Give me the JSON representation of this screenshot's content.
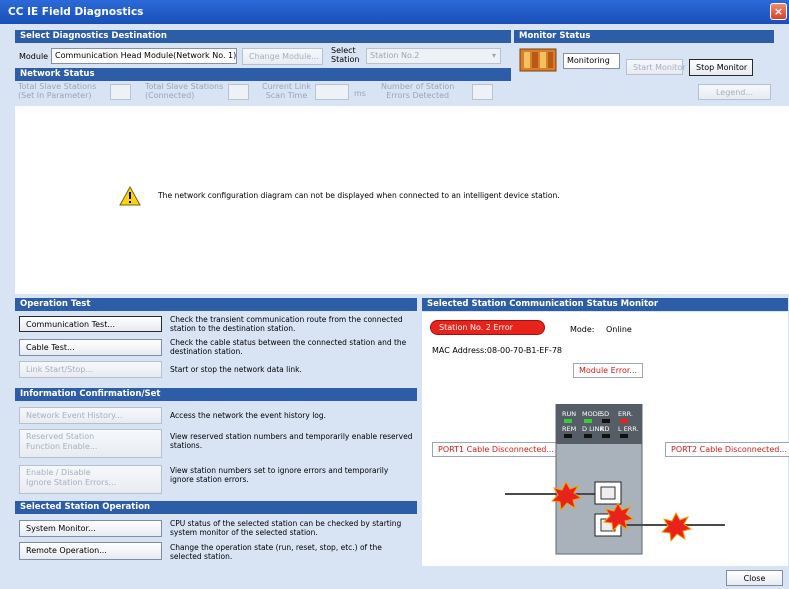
{
  "window": {
    "title": "CC IE Field Diagnostics",
    "close_glyph": "×"
  },
  "destination": {
    "heading": "Select Diagnostics Destination",
    "module_label": "Module",
    "module_value": "Communication Head Module(Network No. 1)",
    "change_module_button": "Change Module...",
    "select_label_1": "Select",
    "select_label_2": "Station",
    "station_value": "Station No.2"
  },
  "monitor": {
    "heading": "Monitor Status",
    "status_text": "Monitoring",
    "start_button": "Start Monitor",
    "stop_button": "Stop Monitor",
    "legend_button": "Legend..."
  },
  "network_status": {
    "heading": "Network Status",
    "total_param_1": "Total Slave Stations",
    "total_param_2": "(Set In Parameter)",
    "total_conn_1": "Total Slave Stations",
    "total_conn_2": "(Connected)",
    "link_scan_1": "Current Link",
    "link_scan_2": "Scan Time",
    "ms_unit": "ms",
    "errors_1": "Number of Station",
    "errors_2": "Errors Detected"
  },
  "diagram_message": "The network configuration diagram can not be displayed when connected to an intelligent device station.",
  "operation_test": {
    "heading": "Operation Test",
    "comm_test_button": "Communication Test...",
    "comm_test_desc": "Check the transient communication route from the connected station to the destination station.",
    "cable_test_button": "Cable Test...",
    "cable_test_desc": "Check the cable status between the connected station and the destination station.",
    "link_button": "Link Start/Stop...",
    "link_desc": "Start or stop the network data link."
  },
  "info": {
    "heading": "Information Confirmation/Set",
    "event_button": "Network Event History...",
    "event_desc": "Access the network the event history log.",
    "reserved_button_1": "Reserved Station",
    "reserved_button_2": "Function Enable...",
    "reserved_desc": "View reserved station numbers and temporarily enable reserved stations.",
    "ignore_button_1": "Enable / Disable",
    "ignore_button_2": "Ignore Station Errors...",
    "ignore_desc": "View station numbers set to ignore errors and temporarily ignore station errors."
  },
  "station_op": {
    "heading": "Selected Station Operation",
    "sysmon_button": "System Monitor...",
    "sysmon_desc": "CPU status of the selected station can be checked by starting system monitor of the selected station.",
    "remote_button": "Remote Operation...",
    "remote_desc": "Change the operation state (run, reset, stop, etc.) of the selected station."
  },
  "status_monitor": {
    "heading": "Selected Station Communication Status Monitor",
    "station_tag": "Station No. 2   Error",
    "mode_label": "Mode:",
    "mode_value": "Online",
    "mac": "MAC Address:08-00-70-B1-EF-78",
    "module_error_button": "Module Error...",
    "port1_button": "PORT1 Cable Disconnected...",
    "port2_button": "PORT2 Cable Disconnected...",
    "led_top": [
      "RUN",
      "MODE",
      "SD",
      "ERR."
    ],
    "led_bottom": [
      "REM",
      "D LINK",
      "RD",
      "L ERR."
    ],
    "led_top_colors": [
      "#3ec83e",
      "#3ec83e",
      "#111111",
      "#e8231c"
    ],
    "led_bottom_colors": [
      "#111111",
      "#111111",
      "#111111",
      "#111111"
    ]
  },
  "footer": {
    "close_button": "Close"
  }
}
